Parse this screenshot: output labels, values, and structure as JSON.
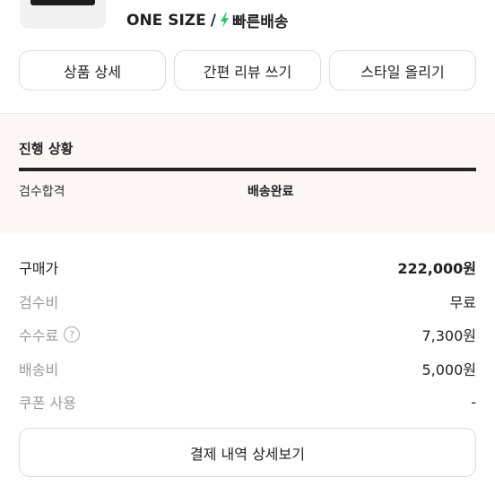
{
  "product": {
    "size": "ONE SIZE",
    "separator": "/",
    "delivery_label": "빠른배송",
    "bolt_color": "#2ec36b"
  },
  "actions": {
    "detail": "상품 상세",
    "review": "간편 리뷰 쓰기",
    "style": "스타일 올리기"
  },
  "progress": {
    "title": "진행 상황",
    "steps": [
      "검수합격",
      "배송완료"
    ],
    "level": 1.0
  },
  "payment": {
    "purchase_label": "구매가",
    "purchase_value": "222,000원",
    "inspection_label": "검수비",
    "inspection_value": "무료",
    "fee_label": "수수료",
    "fee_help": "?",
    "fee_value": "7,300원",
    "shipping_label": "배송비",
    "shipping_value": "5,000원",
    "coupon_label": "쿠폰 사용",
    "coupon_value": "-"
  },
  "detail_button": "결제 내역 상세보기"
}
